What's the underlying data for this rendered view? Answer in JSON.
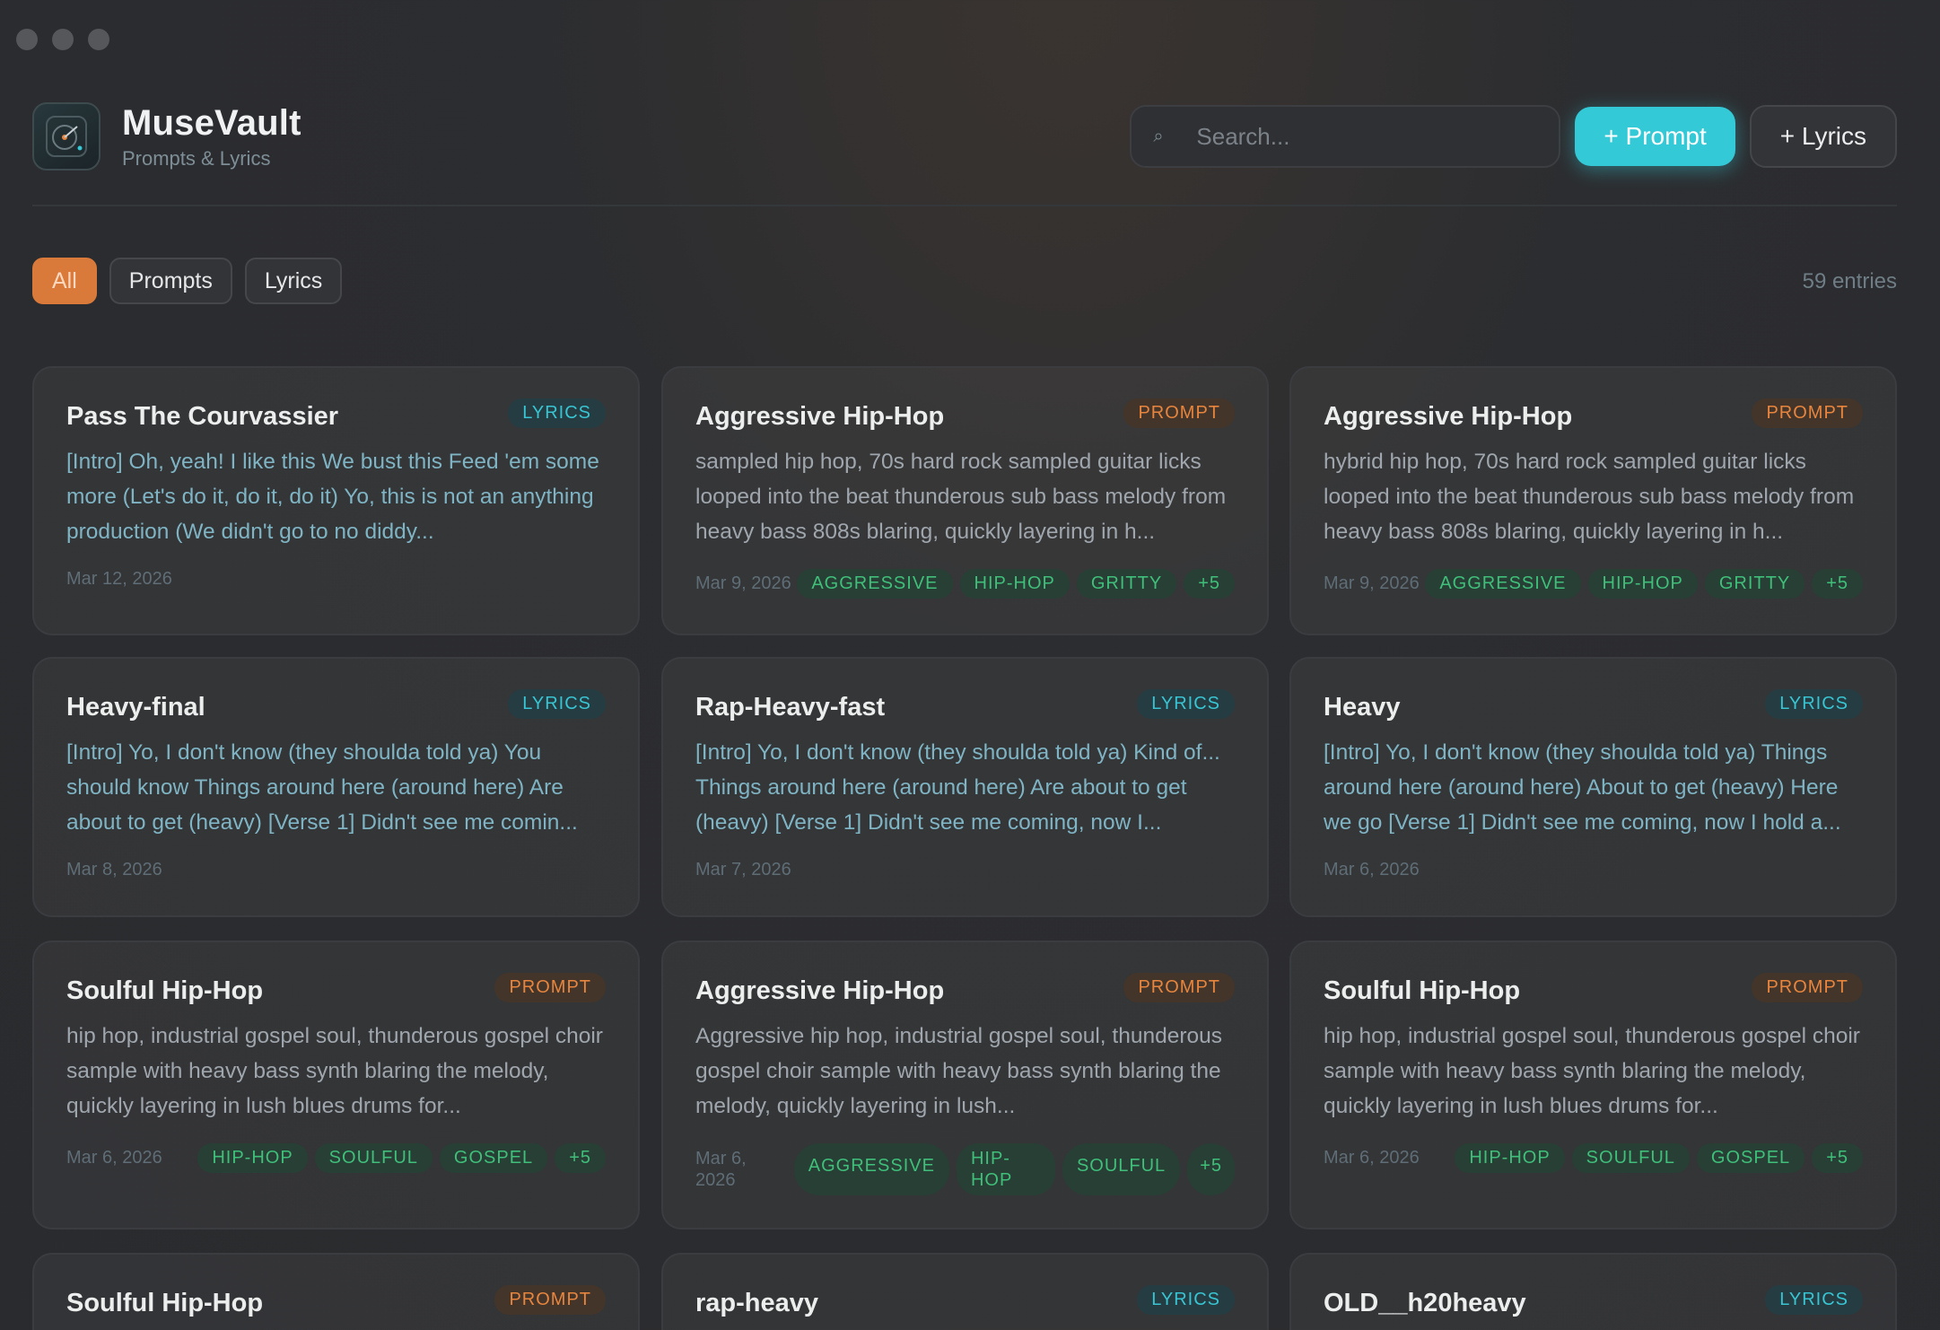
{
  "app": {
    "title": "MuseVault",
    "subtitle": "Prompts & Lyrics"
  },
  "search": {
    "placeholder": "Search..."
  },
  "actions": {
    "add_prompt": "+ Prompt",
    "add_lyrics": "+ Lyrics"
  },
  "filters": [
    "All",
    "Prompts",
    "Lyrics"
  ],
  "active_filter": "All",
  "entry_count": "59 entries",
  "colors": {
    "accent_cyan": "#33c9d6",
    "accent_orange": "#d9793a",
    "tag_green": "#3fbf7a",
    "background": "#2a2b2e"
  },
  "cards": [
    {
      "title": "Pass The Courvassier",
      "badge": "LYRICS",
      "type": "lyrics",
      "text": "[Intro] Oh, yeah! I like this We bust this Feed 'em some more (Let's do it, do it, do it) Yo, this is not an anything production (We didn't go to no diddy...",
      "date": "Mar 12, 2026",
      "tags": []
    },
    {
      "title": "Aggressive Hip-Hop",
      "badge": "PROMPT",
      "type": "prompt",
      "text": "sampled hip hop, 70s hard rock sampled guitar licks looped into the beat thunderous sub bass melody from heavy bass 808s blaring, quickly layering in h...",
      "date": "Mar 9, 2026",
      "tags": [
        "AGGRESSIVE",
        "HIP-HOP",
        "GRITTY",
        "+5"
      ]
    },
    {
      "title": "Aggressive Hip-Hop",
      "badge": "PROMPT",
      "type": "prompt",
      "text": "hybrid hip hop, 70s hard rock sampled guitar licks looped into the beat thunderous sub bass melody from heavy bass 808s blaring, quickly layering in h...",
      "date": "Mar 9, 2026",
      "tags": [
        "AGGRESSIVE",
        "HIP-HOP",
        "GRITTY",
        "+5"
      ]
    },
    {
      "title": "Heavy-final",
      "badge": "LYRICS",
      "type": "lyrics",
      "text": "[Intro] Yo, I don't know (they shoulda told ya) You should know Things around here (around here) Are about to get (heavy) [Verse 1] Didn't see me comin...",
      "date": "Mar 8, 2026",
      "tags": []
    },
    {
      "title": "Rap-Heavy-fast",
      "badge": "LYRICS",
      "type": "lyrics",
      "text": "[Intro] Yo, I don't know (they shoulda told ya) Kind of... Things around here (around here) Are about to get (heavy) [Verse 1] Didn't see me coming, now I...",
      "date": "Mar 7, 2026",
      "tags": []
    },
    {
      "title": "Heavy",
      "badge": "LYRICS",
      "type": "lyrics",
      "text": "[Intro] Yo, I don't know (they shoulda told ya) Things around here (around here) About to get (heavy) Here we go [Verse 1] Didn't see me coming, now I hold a...",
      "date": "Mar 6, 2026",
      "tags": []
    },
    {
      "title": "Soulful Hip-Hop",
      "badge": "PROMPT",
      "type": "prompt",
      "text": "hip hop, industrial gospel soul, thunderous gospel choir sample with heavy bass synth blaring the melody, quickly layering in lush blues drums for...",
      "date": "Mar 6, 2026",
      "tags": [
        "HIP-HOP",
        "SOULFUL",
        "GOSPEL",
        "+5"
      ]
    },
    {
      "title": "Aggressive Hip-Hop",
      "badge": "PROMPT",
      "type": "prompt",
      "text": "Aggressive hip hop, industrial gospel soul, thunderous gospel choir sample with heavy bass synth blaring the melody, quickly layering in lush...",
      "date": "Mar 6, 2026",
      "tags": [
        "AGGRESSIVE",
        "HIP-HOP",
        "SOULFUL",
        "+5"
      ]
    },
    {
      "title": "Soulful Hip-Hop",
      "badge": "PROMPT",
      "type": "prompt",
      "text": "hip hop, industrial gospel soul, thunderous gospel choir sample with heavy bass synth blaring the melody, quickly layering in lush blues drums for...",
      "date": "Mar 6, 2026",
      "tags": [
        "HIP-HOP",
        "SOULFUL",
        "GOSPEL",
        "+5"
      ]
    },
    {
      "title": "Soulful Hip-Hop",
      "badge": "PROMPT",
      "type": "prompt",
      "text": "",
      "date": "",
      "tags": []
    },
    {
      "title": "rap-heavy",
      "badge": "LYRICS",
      "type": "lyrics",
      "text": "",
      "date": "",
      "tags": []
    },
    {
      "title": "OLD__h20heavy",
      "badge": "LYRICS",
      "type": "lyrics",
      "text": "",
      "date": "",
      "tags": []
    }
  ]
}
